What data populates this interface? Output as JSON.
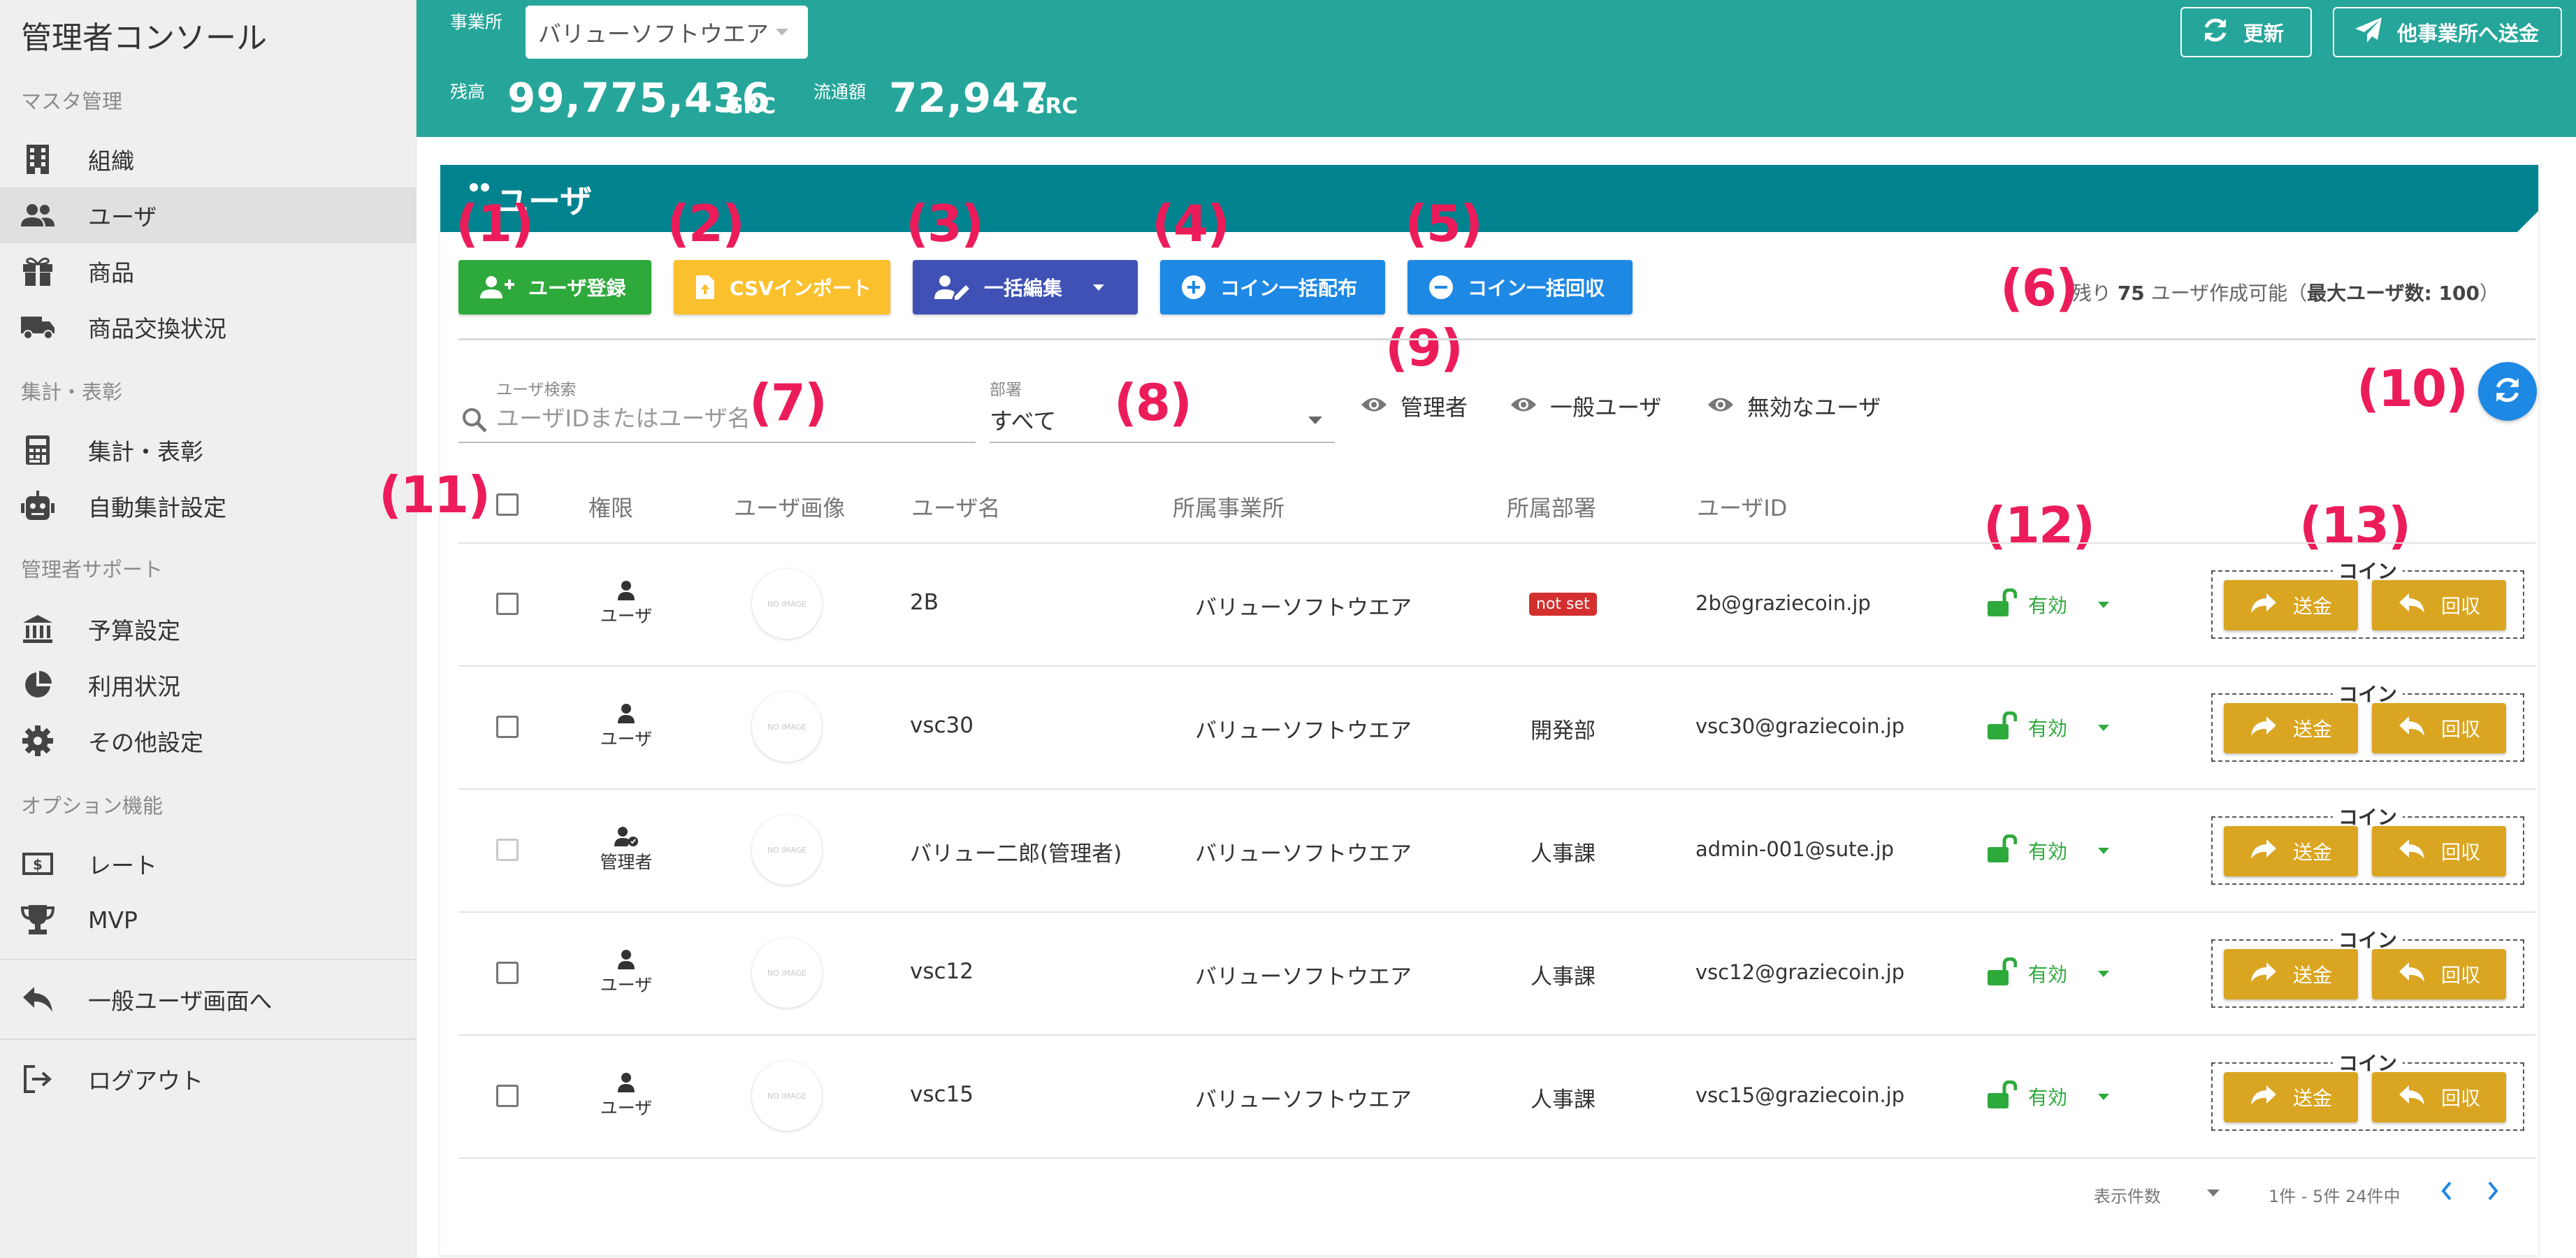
{
  "sidebar": {
    "title": "管理者コンソール",
    "sections": [
      "マスタ管理",
      "集計・表彰",
      "管理者サポート",
      "オプション機能"
    ],
    "items": [
      {
        "label": "組織",
        "icon": "building-icon"
      },
      {
        "label": "ユーザ",
        "icon": "people-icon"
      },
      {
        "label": "商品",
        "icon": "gift-icon"
      },
      {
        "label": "商品交換状況",
        "icon": "truck-icon"
      },
      {
        "label": "集計・表彰",
        "icon": "calculator-icon"
      },
      {
        "label": "自動集計設定",
        "icon": "robot-icon"
      },
      {
        "label": "予算設定",
        "icon": "bank-icon"
      },
      {
        "label": "利用状況",
        "icon": "pie-chart-icon"
      },
      {
        "label": "その他設定",
        "icon": "gear-icon"
      },
      {
        "label": "レート",
        "icon": "money-icon"
      },
      {
        "label": "MVP",
        "icon": "trophy-icon"
      },
      {
        "label": "一般ユーザ画面へ",
        "icon": "reply-icon"
      },
      {
        "label": "ログアウト",
        "icon": "logout-icon"
      }
    ],
    "active_index": 1
  },
  "header": {
    "office_label": "事業所",
    "office_value": "バリューソフトウエア",
    "balance_label": "残高",
    "balance_value": "99,775,436",
    "circulation_label": "流通額",
    "circulation_value": "72,947",
    "unit": "GRC",
    "refresh_label": "更新",
    "send_other_label": "他事業所へ送金"
  },
  "card": {
    "title": "ユーザ",
    "buttons": {
      "register": "ユーザ登録",
      "csv_import": "CSVインポート",
      "bulk_edit": "一括編集",
      "bulk_distribute": "コイン一括配布",
      "bulk_collect": "コイン一括回収"
    },
    "remaining_prefix": "残り",
    "remaining_count": "75",
    "remaining_suffix": "ユーザ作成可能（",
    "max_users_label": "最大ユーザ数: 100",
    "remaining_close": "）",
    "colors": {
      "register": "#2eaa3c",
      "csv": "#fbc02d",
      "bulk_edit": "#3f51b5",
      "coin_bulk": "#1e88e5",
      "coin": "#daa520",
      "annotation": "#ec1c5a"
    }
  },
  "annotations": [
    "(1)",
    "(2)",
    "(3)",
    "(4)",
    "(5)",
    "(6)",
    "(7)",
    "(8)",
    "(9)",
    "(10)",
    "(11)",
    "(12)",
    "(13)"
  ],
  "filters": {
    "search_label": "ユーザ検索",
    "search_placeholder": "ユーザIDまたはユーザ名",
    "dept_label": "部署",
    "dept_value": "すべて",
    "toggles": [
      "管理者",
      "一般ユーザ",
      "無効なユーザ"
    ]
  },
  "table": {
    "headers": [
      "権限",
      "ユーザ画像",
      "ユーザ名",
      "所属事業所",
      "所属部署",
      "ユーザID"
    ],
    "no_image": "NO IMAGE",
    "coin_legend": "コイン",
    "send_label": "送金",
    "collect_label": "回収",
    "rows": [
      {
        "role": "ユーザ",
        "role_icon": "person-icon",
        "name": "2B",
        "office": "バリューソフトウエア",
        "dept": "not set",
        "dept_is_badge": true,
        "user_id": "2b@graziecoin.jp",
        "status": "有効",
        "checkbox_disabled": false
      },
      {
        "role": "ユーザ",
        "role_icon": "person-icon",
        "name": "vsc30",
        "office": "バリューソフトウエア",
        "dept": "開発部",
        "dept_is_badge": false,
        "user_id": "vsc30@graziecoin.jp",
        "status": "有効",
        "checkbox_disabled": false
      },
      {
        "role": "管理者",
        "role_icon": "admin-person-icon",
        "name": "バリュー二郎(管理者)",
        "office": "バリューソフトウエア",
        "dept": "人事課",
        "dept_is_badge": false,
        "user_id": "admin-001@sute.jp",
        "status": "有効",
        "checkbox_disabled": true
      },
      {
        "role": "ユーザ",
        "role_icon": "person-icon",
        "name": "vsc12",
        "office": "バリューソフトウエア",
        "dept": "人事課",
        "dept_is_badge": false,
        "user_id": "vsc12@graziecoin.jp",
        "status": "有効",
        "checkbox_disabled": false
      },
      {
        "role": "ユーザ",
        "role_icon": "person-icon",
        "name": "vsc15",
        "office": "バリューソフトウエア",
        "dept": "人事課",
        "dept_is_badge": false,
        "user_id": "vsc15@graziecoin.jp",
        "status": "有効",
        "checkbox_disabled": false
      }
    ]
  },
  "pagination": {
    "per_page_label": "表示件数",
    "range_text": "1件 - 5件 24件中"
  }
}
